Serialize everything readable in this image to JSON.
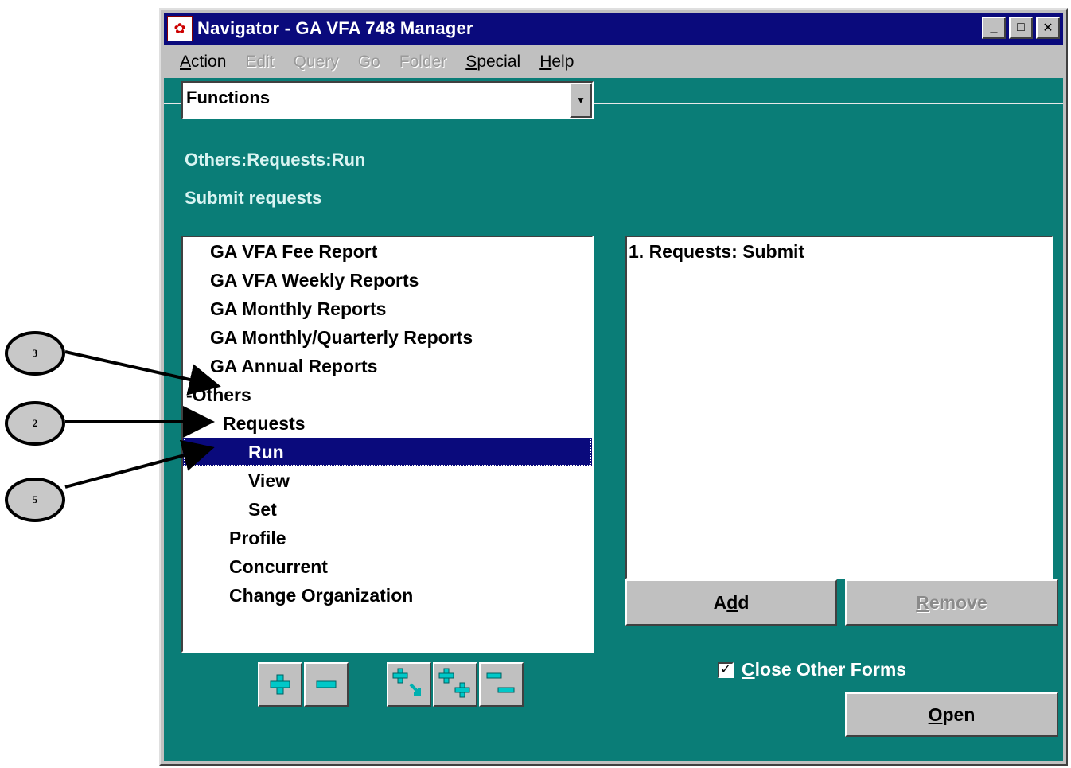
{
  "window": {
    "title": "Navigator - GA VFA 748 Manager",
    "controls": {
      "minimize": "_",
      "maximize": "□",
      "close": "✕"
    }
  },
  "menu": [
    {
      "label": "Action",
      "mnemonic": "A",
      "rest": "ction",
      "enabled": true
    },
    {
      "label": "Edit",
      "enabled": false
    },
    {
      "label": "Query",
      "enabled": false
    },
    {
      "label": "Go",
      "enabled": false
    },
    {
      "label": "Folder",
      "enabled": false
    },
    {
      "label": "Special",
      "mnemonic": "S",
      "rest": "pecial",
      "enabled": true
    },
    {
      "label": "Help",
      "mnemonic": "H",
      "rest": "elp",
      "enabled": true
    }
  ],
  "combo": {
    "value": "Functions",
    "arrow": "▼"
  },
  "path_text": "Others:Requests:Run",
  "description": "Submit requests",
  "tree": [
    {
      "label": "GA VFA Fee Report",
      "level": 1
    },
    {
      "label": "GA VFA Weekly Reports",
      "level": 1
    },
    {
      "label": "GA Monthly Reports",
      "level": 1
    },
    {
      "label": "GA Monthly/Quarterly Reports",
      "level": 1
    },
    {
      "label": "GA Annual Reports",
      "level": 1
    },
    {
      "label": "-Others",
      "level": 0
    },
    {
      "label": "Requests",
      "level": 2
    },
    {
      "label": "Run",
      "level": 4,
      "selected": true
    },
    {
      "label": "View",
      "level": 4
    },
    {
      "label": "Set",
      "level": 4
    },
    {
      "label": "Profile",
      "level": 3
    },
    {
      "label": "Concurrent",
      "level": 3
    },
    {
      "label": "Change Organization",
      "level": 3
    }
  ],
  "top_ten": [
    "1. Requests: Submit"
  ],
  "buttons": {
    "add": {
      "before": "A",
      "mnemonic": "d",
      "after": "d"
    },
    "remove": {
      "before": "",
      "mnemonic": "R",
      "after": "emove"
    },
    "open": {
      "before": "",
      "mnemonic": "O",
      "after": "pen"
    }
  },
  "close_other_forms": {
    "checked": true,
    "mark": "✓",
    "mnemonic": "C",
    "rest": "lose Other Forms"
  },
  "callouts": [
    {
      "label": "3"
    },
    {
      "label": "2"
    },
    {
      "label": "5"
    }
  ]
}
